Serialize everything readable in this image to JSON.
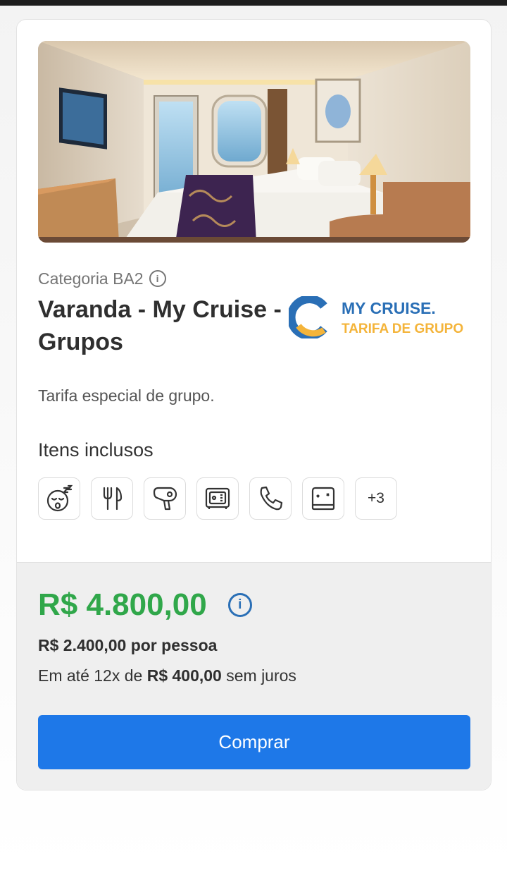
{
  "cabin": {
    "category_label": "Categoria BA2",
    "title": "Varanda - My Cruise - Grupos",
    "description": "Tarifa especial de grupo."
  },
  "brand": {
    "name": "MY CRUISE.",
    "subtitle": "TARIFA DE GRUPO",
    "primary_color": "#2a6fb6",
    "accent_color": "#f4b43a"
  },
  "amenities": {
    "heading": "Itens inclusos",
    "icons": [
      "sleep-face-icon",
      "cutlery-icon",
      "hair-dryer-icon",
      "safe-icon",
      "phone-icon",
      "bed-sheet-icon"
    ],
    "more_label": "+3"
  },
  "pricing": {
    "total": "R$ 4.800,00",
    "per_person": "R$ 2.400,00 por pessoa",
    "installments_prefix": "Em até 12x de",
    "installment_value": "R$ 400,00",
    "installments_suffix": "sem juros",
    "price_color": "#30a74a"
  },
  "actions": {
    "buy_label": "Comprar",
    "button_color": "#1e78e8"
  }
}
